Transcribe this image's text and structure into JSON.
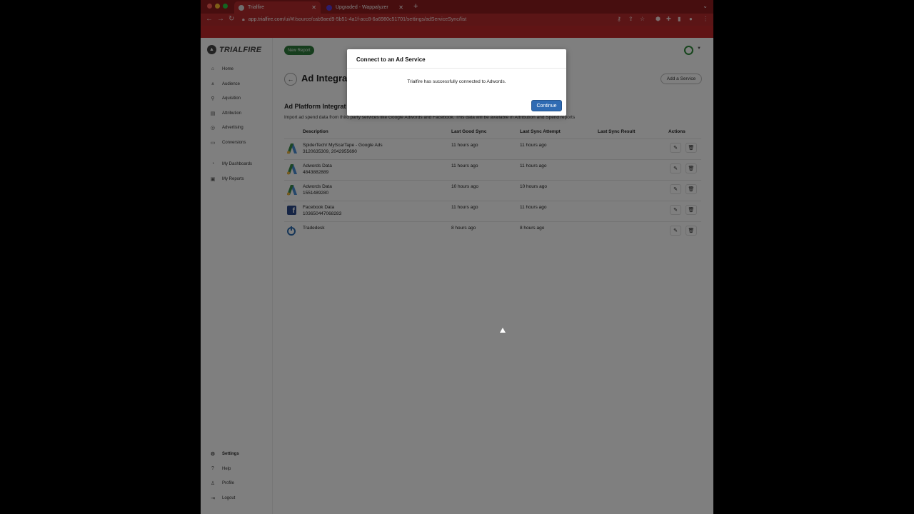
{
  "browser": {
    "tabs": [
      {
        "title": "Trialfire",
        "close": "✕"
      },
      {
        "title": "Upgraded - Wappalyzer",
        "close": "✕"
      }
    ],
    "new_tab": "+",
    "tab_menu": "⌄",
    "url_host": "app.trialfire.com",
    "url_path": "/ui/#!/source/cab9aed9-5b51-4a1f-acc8-6a6980c51701/settings/adServiceSync/list"
  },
  "app": {
    "logo_text": "TRIALFIRE",
    "new_report": "New Report",
    "sidebar": {
      "items": [
        {
          "label": "Home",
          "icon": "home-icon"
        },
        {
          "label": "Audience",
          "icon": "audience-icon"
        },
        {
          "label": "Aquisition",
          "icon": "acquisition-icon"
        },
        {
          "label": "Attribution",
          "icon": "attribution-icon"
        },
        {
          "label": "Advertising",
          "icon": "advertising-icon"
        },
        {
          "label": "Conversions",
          "icon": "conversions-icon"
        },
        {
          "label": "My Dashboards",
          "icon": "dashboards-icon"
        },
        {
          "label": "My Reports",
          "icon": "reports-icon"
        }
      ],
      "bottom_items": [
        {
          "label": "Settings",
          "icon": "settings-icon"
        },
        {
          "label": "Help",
          "icon": "help-icon"
        },
        {
          "label": "Profile",
          "icon": "profile-icon"
        },
        {
          "label": "Logout",
          "icon": "logout-icon"
        }
      ]
    },
    "page_title": "Ad Integrat",
    "add_service": "Add a Service",
    "section_title": "Ad Platform Integrat",
    "section_desc": "Import ad spend data from third party services like Google Adwords and Facebook. This data will be available in Attribution and Spend reports",
    "table": {
      "headers": [
        "Description",
        "Last Good Sync",
        "Last Sync Attempt",
        "Last Sync Result",
        "Actions"
      ],
      "rows": [
        {
          "service": "adwords",
          "name": "SpiderTech/ MyScarTape - Google Ads",
          "account": "3120635309, 2042955690",
          "last_good_sync": "11 hours ago",
          "last_attempt": "11 hours ago",
          "result": ""
        },
        {
          "service": "adwords",
          "name": "Adwords Data",
          "account": "4843882889",
          "last_good_sync": "11 hours ago",
          "last_attempt": "11 hours ago",
          "result": ""
        },
        {
          "service": "adwords",
          "name": "Adwords Data",
          "account": "1551489280",
          "last_good_sync": "10 hours ago",
          "last_attempt": "10 hours ago",
          "result": ""
        },
        {
          "service": "facebook",
          "name": "Facebook Data",
          "account": "103650447068283",
          "last_good_sync": "11 hours ago",
          "last_attempt": "11 hours ago",
          "result": ""
        },
        {
          "service": "tradedesk",
          "name": "Tradedesk",
          "account": "",
          "last_good_sync": "8 hours ago",
          "last_attempt": "8 hours ago",
          "result": ""
        }
      ]
    }
  },
  "modal": {
    "title": "Connect to an Ad Service",
    "message": "Trialfire has successfully connected to Adwords.",
    "continue_label": "Continue"
  },
  "colors": {
    "chrome_dark": "#8e1c1f",
    "chrome": "#b72a2c",
    "accent_button": "#2f6bb3",
    "green": "#2c7a3a"
  }
}
